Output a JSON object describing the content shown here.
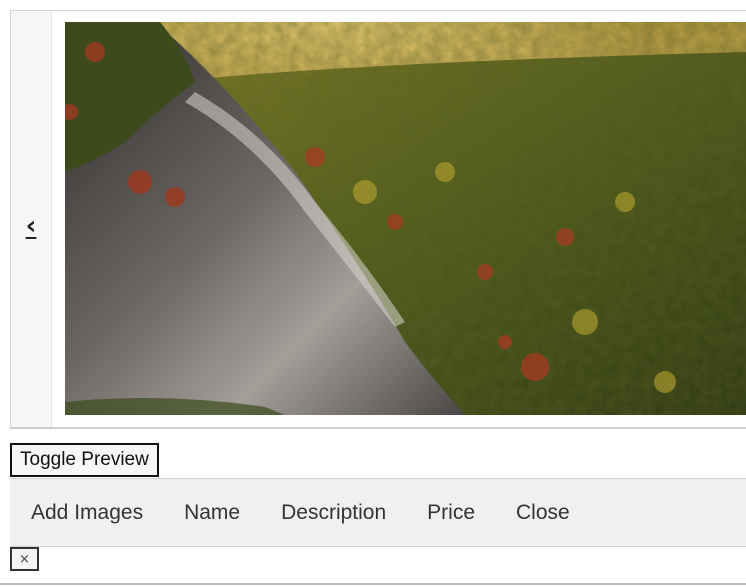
{
  "carousel": {
    "prev_label": "‹",
    "photo_colors": {
      "sky": "#c9a94a",
      "haze": "#e0c36a",
      "forest_dark": "#2f3a14",
      "forest_mid": "#5c6a1f",
      "forest_light": "#8e8a2a",
      "autumn_red": "#a83a22",
      "rock_dark": "#3d3a3a",
      "rock_light": "#9a9590"
    }
  },
  "toggle_label": "Toggle Preview",
  "nav": {
    "items": [
      "Add Images",
      "Name",
      "Description",
      "Price",
      "Close"
    ]
  },
  "close_x_label": "×"
}
